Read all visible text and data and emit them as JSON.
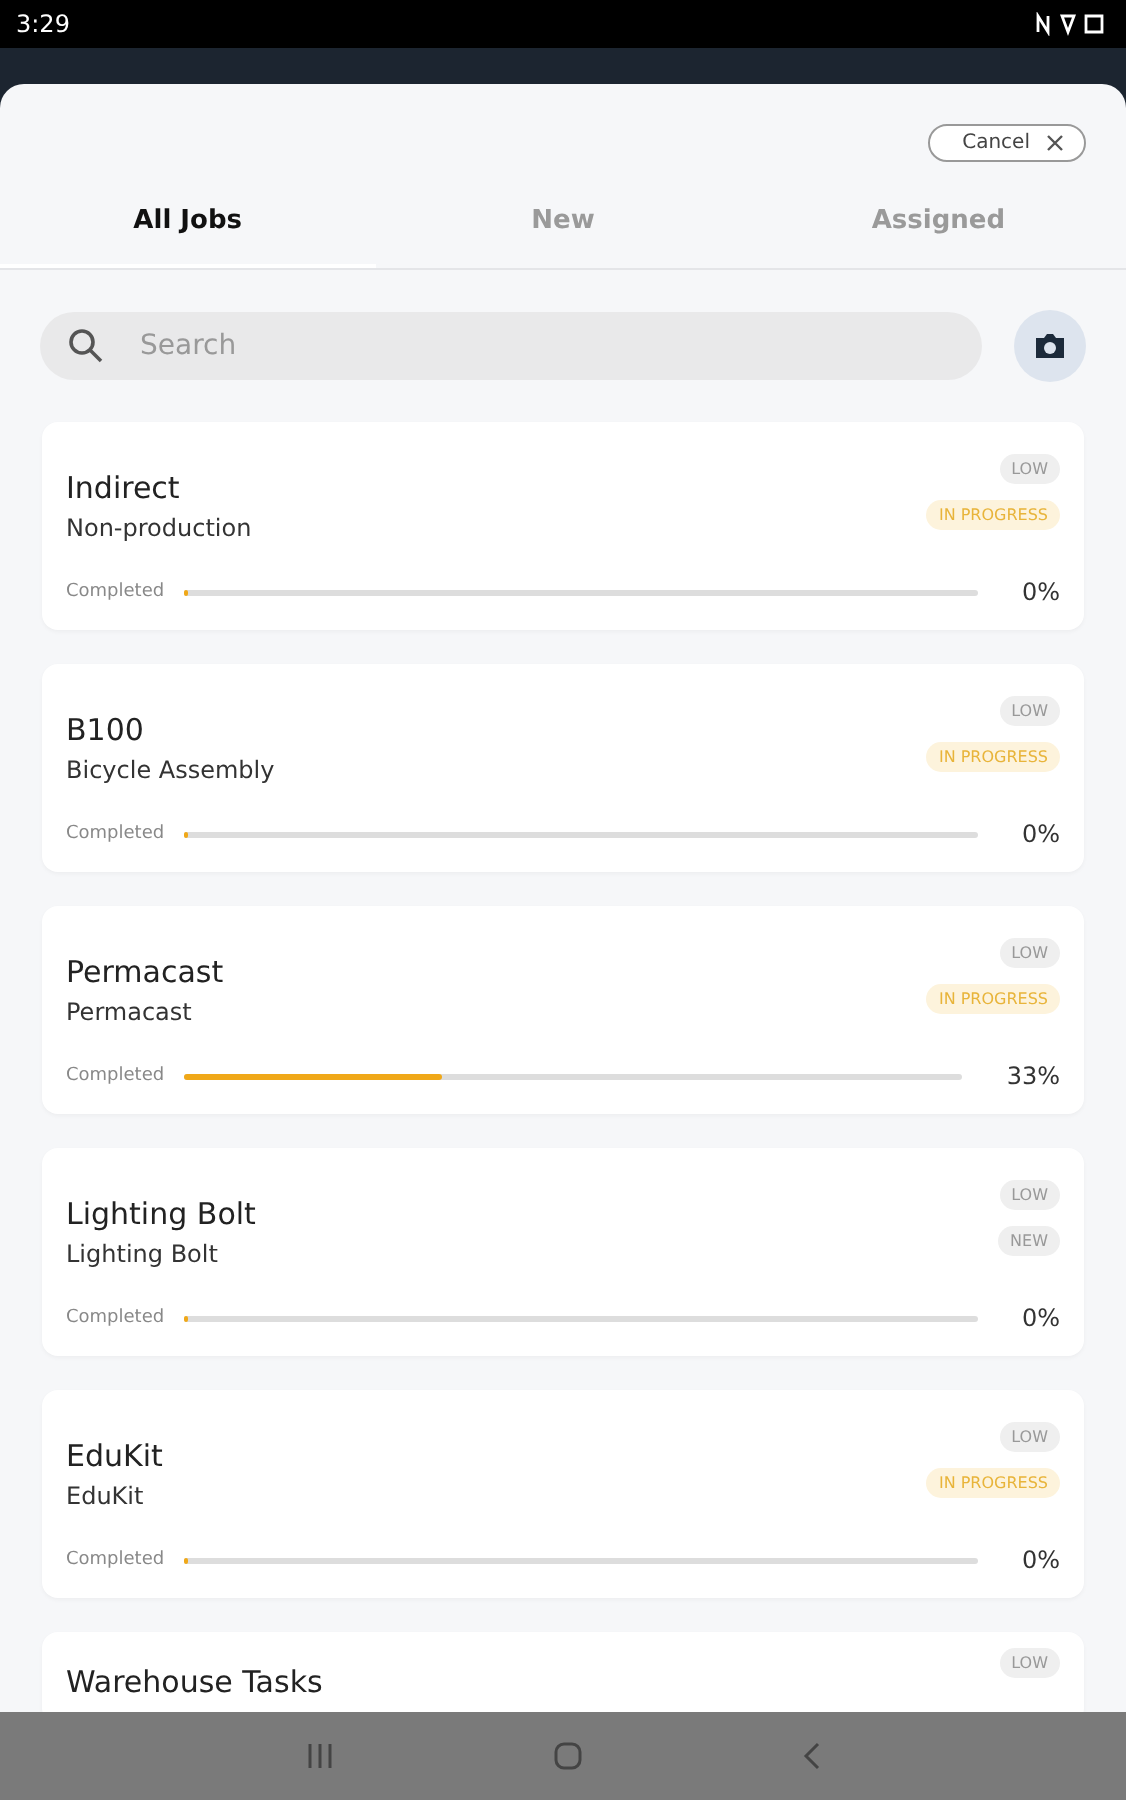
{
  "status_bar": {
    "time": "3:29"
  },
  "cancel_button": {
    "label": "Cancel"
  },
  "tabs": [
    {
      "label": "All Jobs",
      "selected": true
    },
    {
      "label": "New",
      "selected": false
    },
    {
      "label": "Assigned",
      "selected": false
    }
  ],
  "search": {
    "placeholder": "Search"
  },
  "jobs": [
    {
      "title": "Indirect",
      "subtitle": "Non-production",
      "priority": "LOW",
      "status": "IN PROGRESS",
      "kind": "in_progress",
      "progress_label": "Completed",
      "level": 0,
      "percent": "0%"
    },
    {
      "title": "B100",
      "subtitle": "Bicycle Assembly",
      "priority": "LOW",
      "status": "IN PROGRESS",
      "kind": "in_progress",
      "progress_label": "Completed",
      "level": 0,
      "percent": "0%"
    },
    {
      "title": "Permacast",
      "subtitle": "Permacast",
      "priority": "LOW",
      "status": "IN PROGRESS",
      "kind": "in_progress",
      "progress_label": "Completed",
      "level": 0.33,
      "percent": "33%"
    },
    {
      "title": "Lighting Bolt",
      "subtitle": "Lighting Bolt",
      "priority": "LOW",
      "status": "NEW",
      "kind": "new",
      "progress_label": "Completed",
      "level": 0,
      "percent": "0%"
    },
    {
      "title": "EduKit",
      "subtitle": "EduKit",
      "priority": "LOW",
      "status": "IN PROGRESS",
      "kind": "in_progress",
      "progress_label": "Completed",
      "level": 0,
      "percent": "0%"
    }
  ],
  "partial_job": {
    "title": "Warehouse Tasks",
    "priority": "LOW"
  }
}
